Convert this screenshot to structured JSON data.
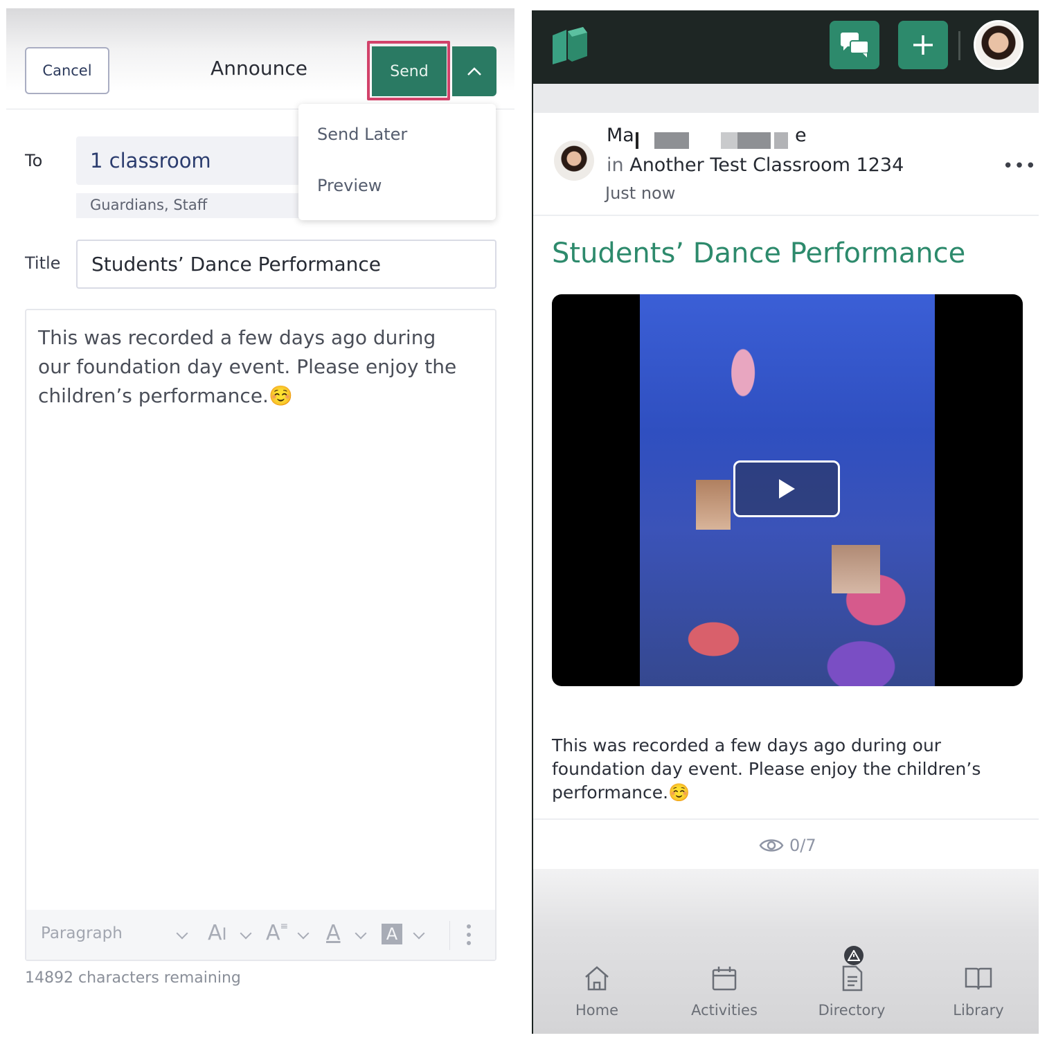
{
  "composer": {
    "cancel_label": "Cancel",
    "title": "Announce",
    "send_label": "Send",
    "menu": [
      "Send Later",
      "Preview"
    ],
    "to_label": "To",
    "to_value": "1 classroom",
    "to_audience": "Guardians, Staff",
    "title_label": "Title",
    "title_value": "Students’ Dance Performance",
    "body": "This was recorded a few days ago during our foundation day event. Please enjoy the children’s performance.☺️",
    "toolbar": {
      "paragraph": "Paragraph",
      "icons": [
        "font-size-icon",
        "text-style-icon",
        "text-color-icon",
        "highlight-icon",
        "more-vertical-icon"
      ]
    },
    "chars_remaining": "14892 characters remaining"
  },
  "feed": {
    "author_visible_start": "Ma",
    "author_visible_end": "e",
    "in_word": "in",
    "classroom": "Another Test Classroom 1234",
    "time": "Just now",
    "more": "•••",
    "post_title": "Students’ Dance Performance",
    "post_body": "This was recorded a few days ago during our foundation day event. Please enjoy the children’s performance.☺️",
    "views": "0/7",
    "nav": [
      "Home",
      "Activities",
      "Directory",
      "Library"
    ]
  },
  "colors": {
    "accent": "#2d8a6c",
    "send_button": "#2a7a63",
    "highlight": "#d2426a",
    "header": "#1e2624"
  }
}
